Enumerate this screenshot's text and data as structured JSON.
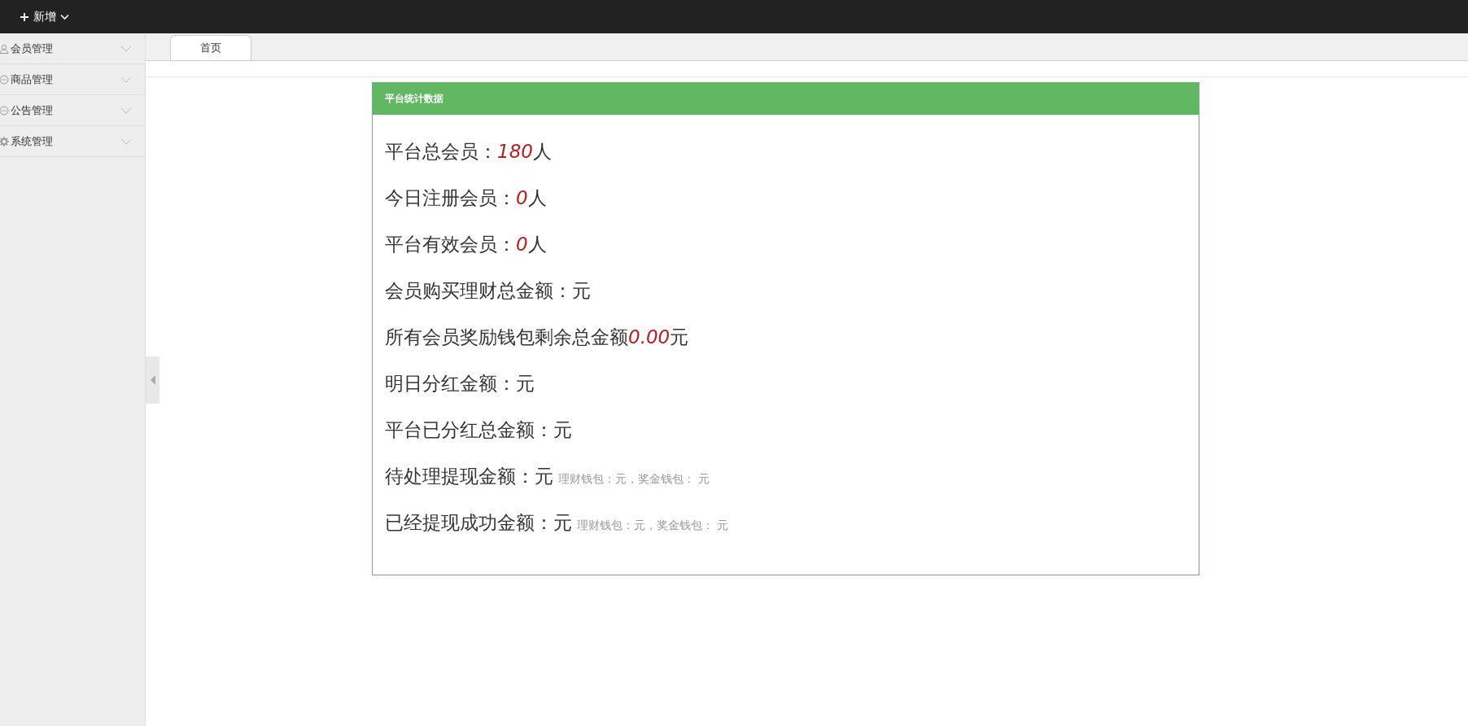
{
  "top_bar": {
    "new_button": "新增"
  },
  "sidebar": {
    "items": [
      {
        "label": "会员管理",
        "expanded": false
      },
      {
        "label": "商品管理",
        "expanded": false
      },
      {
        "label": "公告管理",
        "expanded": false
      },
      {
        "label": "系统管理",
        "expanded": false
      }
    ]
  },
  "tabs": [
    {
      "label": "首页",
      "selected": true
    }
  ],
  "card": {
    "title": "平台统计数据",
    "rows": [
      {
        "label": "平台总会员：",
        "value": "180",
        "unit": "人"
      },
      {
        "label": "今日注册会员：",
        "value": "0",
        "unit": "人"
      },
      {
        "label": "平台有效会员：",
        "value": "0",
        "unit": "人"
      },
      {
        "label": "会员购买理财总金额：",
        "unit": "元"
      },
      {
        "label": "所有会员奖励钱包剩余总金额",
        "value": "0.00",
        "unit": "元"
      },
      {
        "label": "明日分红金额：",
        "unit": "元"
      },
      {
        "label": "平台已分红总金额：",
        "unit": "元"
      },
      {
        "label": "待处理提现金额：",
        "unit": "元",
        "note": "理财钱包：元，奖金钱包： 元"
      },
      {
        "label": "已经提现成功金额：",
        "unit": "元",
        "note": "理财钱包：元，奖金钱包： 元"
      }
    ]
  }
}
